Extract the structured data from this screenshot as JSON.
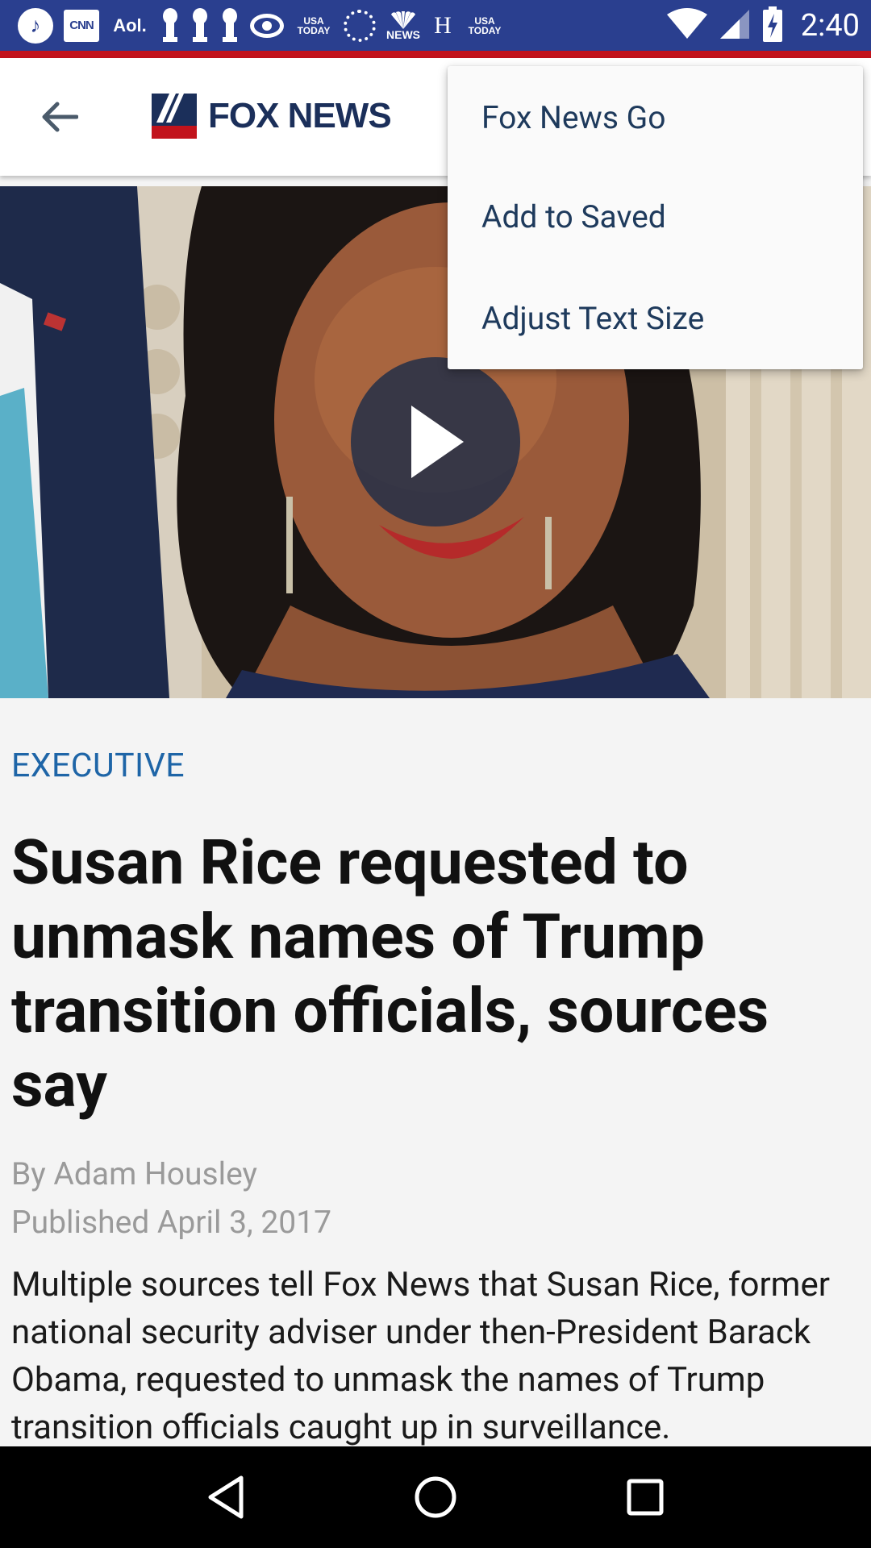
{
  "status_bar": {
    "time": "2:40",
    "notification_icons": [
      {
        "name": "music-app-icon",
        "text": "♪"
      },
      {
        "name": "cnn-icon",
        "text": "CNN"
      },
      {
        "name": "aol-icon",
        "text": "Aol."
      },
      {
        "name": "pin-icon",
        "text": ""
      },
      {
        "name": "pin-icon",
        "text": ""
      },
      {
        "name": "pin-icon",
        "text": ""
      },
      {
        "name": "cbs-icon",
        "text": ""
      },
      {
        "name": "usa-today-icon",
        "text": "USA TODAY"
      },
      {
        "name": "dotted-circle-icon",
        "text": ""
      },
      {
        "name": "nbc-news-icon",
        "text": "NEWS"
      },
      {
        "name": "h-icon",
        "text": "H"
      },
      {
        "name": "usa-today-icon",
        "text": "USA TODAY"
      }
    ],
    "usa_today_label_1": "USA",
    "usa_today_label_2": "TODAY",
    "nbc_label": "NEWS",
    "cnn_label": "CNN",
    "aol_label": "Aol.",
    "h_label": "H"
  },
  "app_bar": {
    "logo_text": "FOX NEWS"
  },
  "menu": {
    "items": [
      {
        "label": "Fox News Go"
      },
      {
        "label": "Add to Saved"
      },
      {
        "label": "Adjust Text Size"
      }
    ]
  },
  "article": {
    "category": "EXECUTIVE",
    "headline": "Susan Rice requested to unmask names of Trump transition officials, sources say",
    "byline": "By Adam Housley",
    "published": "Published April 3, 2017",
    "body": "Multiple sources tell Fox News that Susan Rice, former national security adviser under then-President Barack Obama, requested to unmask the names of Trump transition officials caught up in surveillance."
  },
  "colors": {
    "status_bar": "#2a3f8f",
    "accent_red": "#c2131c",
    "category_blue": "#1e65a7",
    "menu_text": "#1e3a5c"
  }
}
